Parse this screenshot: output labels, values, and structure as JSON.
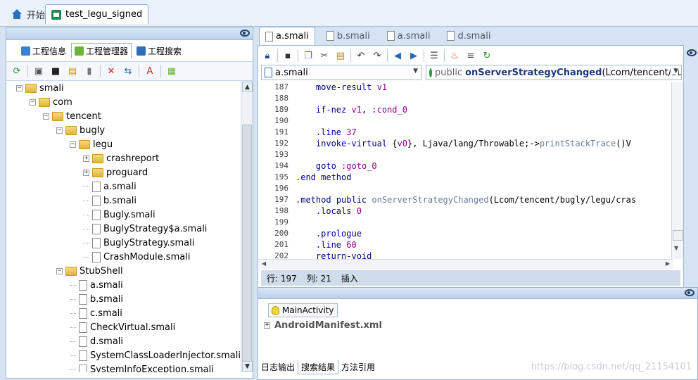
{
  "top_tabs": [
    {
      "label": "开始"
    },
    {
      "label": "test_legu_signed"
    }
  ],
  "left": {
    "subtabs": [
      {
        "label": "工程信息"
      },
      {
        "label": "工程管理器"
      },
      {
        "label": "工程搜索"
      }
    ],
    "tree": [
      {
        "label": "smali",
        "kind": "folder",
        "depth": 0,
        "expander": "minus"
      },
      {
        "label": "com",
        "kind": "folder",
        "depth": 1,
        "expander": "minus"
      },
      {
        "label": "tencent",
        "kind": "folder",
        "depth": 2,
        "expander": "minus"
      },
      {
        "label": "bugly",
        "kind": "folder",
        "depth": 3,
        "expander": "minus"
      },
      {
        "label": "legu",
        "kind": "folder",
        "depth": 4,
        "expander": "minus"
      },
      {
        "label": "crashreport",
        "kind": "folder",
        "depth": 5,
        "expander": "plus"
      },
      {
        "label": "proguard",
        "kind": "folder",
        "depth": 5,
        "expander": "plus"
      },
      {
        "label": "a.smali",
        "kind": "file",
        "depth": 5,
        "expander": ""
      },
      {
        "label": "b.smali",
        "kind": "file",
        "depth": 5,
        "expander": ""
      },
      {
        "label": "Bugly.smali",
        "kind": "file",
        "depth": 5,
        "expander": ""
      },
      {
        "label": "BuglyStrategy$a.smali",
        "kind": "file",
        "depth": 5,
        "expander": ""
      },
      {
        "label": "BuglyStrategy.smali",
        "kind": "file",
        "depth": 5,
        "expander": ""
      },
      {
        "label": "CrashModule.smali",
        "kind": "file",
        "depth": 5,
        "expander": ""
      },
      {
        "label": "StubShell",
        "kind": "folder",
        "depth": 3,
        "expander": "minus"
      },
      {
        "label": "a.smali",
        "kind": "file",
        "depth": 4,
        "expander": ""
      },
      {
        "label": "b.smali",
        "kind": "file",
        "depth": 4,
        "expander": ""
      },
      {
        "label": "c.smali",
        "kind": "file",
        "depth": 4,
        "expander": ""
      },
      {
        "label": "CheckVirtual.smali",
        "kind": "file",
        "depth": 4,
        "expander": ""
      },
      {
        "label": "d.smali",
        "kind": "file",
        "depth": 4,
        "expander": ""
      },
      {
        "label": "SystemClassLoaderInjector.smali",
        "kind": "file",
        "depth": 4,
        "expander": ""
      },
      {
        "label": "SystemInfoException.smali",
        "kind": "file",
        "depth": 4,
        "expander": ""
      }
    ]
  },
  "editor": {
    "tabs": [
      {
        "label": "a.smali"
      },
      {
        "label": "b.smali"
      },
      {
        "label": "a.smali"
      },
      {
        "label": "d.smali"
      }
    ],
    "file_combo": "a.smali",
    "method_combo": {
      "modifier": "public",
      "name": "onServerStrategyChanged",
      "sig": "(Lcom/tencent/bugly/"
    },
    "lines": [
      {
        "n": "187",
        "text": "    move-result v1"
      },
      {
        "n": "188",
        "text": ""
      },
      {
        "n": "189",
        "text": "    if-nez v1, :cond_0"
      },
      {
        "n": "190",
        "text": ""
      },
      {
        "n": "191",
        "text": "    .line 37"
      },
      {
        "n": "192",
        "text": "    invoke-virtual {v0}, Ljava/lang/Throwable;->printStackTrace()V"
      },
      {
        "n": "193",
        "text": ""
      },
      {
        "n": "194",
        "text": "    goto :goto_0"
      },
      {
        "n": "195",
        "text": ".end method"
      },
      {
        "n": "196",
        "text": ""
      },
      {
        "n": "197",
        "text": ".method public onServerStrategyChanged(Lcom/tencent/bugly/legu/cras"
      },
      {
        "n": "198",
        "text": "    .locals 0"
      },
      {
        "n": "199",
        "text": ""
      },
      {
        "n": "200",
        "text": "    .prologue"
      },
      {
        "n": "201",
        "text": "    .line 60"
      },
      {
        "n": "202",
        "text": "    return-void"
      }
    ],
    "status": {
      "line_label": "行: 197",
      "col_label": "列: 21",
      "mode": "插入"
    }
  },
  "bottom": {
    "tab": "MainActivity",
    "manifest": "AndroidManifest.xml",
    "tabs": [
      {
        "label": "日志输出"
      },
      {
        "label": "搜索结果"
      },
      {
        "label": "方法引用"
      }
    ]
  },
  "watermark": "https://blog.csdn.net/qq_21154101"
}
